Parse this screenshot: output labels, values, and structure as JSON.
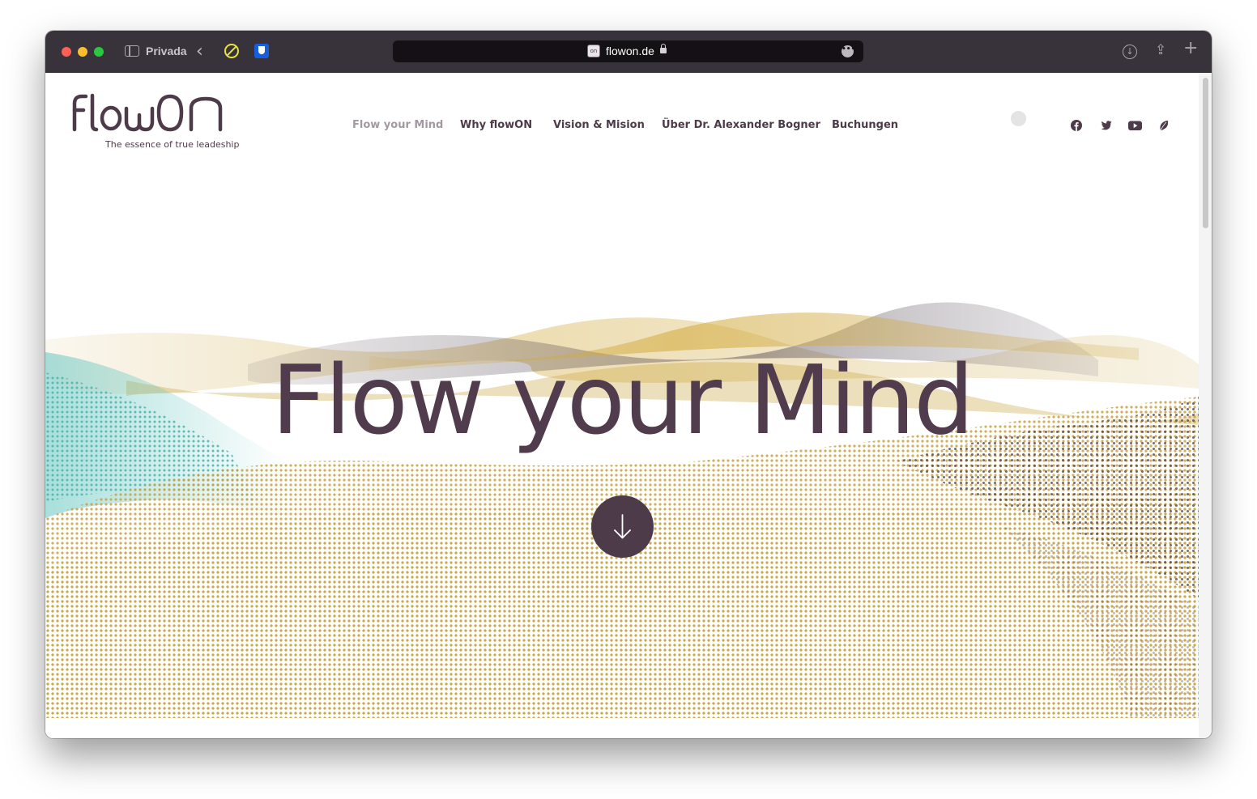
{
  "browser": {
    "private_label": "Privada",
    "url": "flowon.de",
    "favicon_text": "on"
  },
  "site": {
    "tagline": "The essence of true leadeship",
    "nav": [
      {
        "label": "Flow your Mind",
        "active": true
      },
      {
        "label": "Why flowON",
        "active": false
      },
      {
        "label": "Vision & Mision",
        "active": false
      },
      {
        "label": "Über Dr. Alexander Bogner",
        "active": false
      },
      {
        "label": "Buchungen",
        "active": false
      }
    ],
    "social": [
      "facebook-icon",
      "twitter-icon",
      "youtube-icon",
      "leaf-icon"
    ]
  },
  "hero": {
    "title": "Flow your Mind"
  },
  "colors": {
    "brand": "#4d3b49",
    "gold": "#c9a23c",
    "teal": "#5fc4be",
    "titlebar": "#38323a"
  }
}
